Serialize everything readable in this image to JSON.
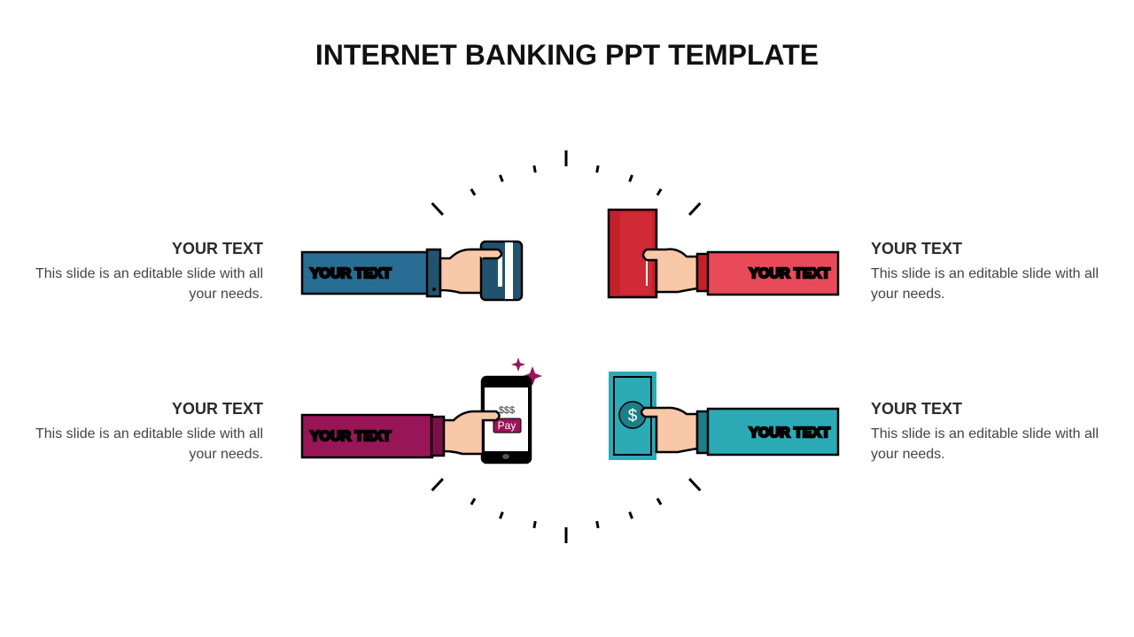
{
  "title": "INTERNET BANKING PPT TEMPLATE",
  "items": [
    {
      "heading": "YOUR TEXT",
      "body": "This slide is an editable slide with all your needs.",
      "arm_label": "YOUR TEXT",
      "color": "#286d94",
      "icon": "credit-card-icon"
    },
    {
      "heading": "YOUR TEXT",
      "body": "This slide is an editable slide with all your needs.",
      "arm_label": "YOUR TEXT",
      "color": "#e84a5a",
      "icon": "red-envelope-icon"
    },
    {
      "heading": "YOUR TEXT",
      "body": "This slide is an editable slide with all your needs.",
      "arm_label": "YOUR TEXT",
      "color": "#981558",
      "icon": "smartphone-pay-icon"
    },
    {
      "heading": "YOUR TEXT",
      "body": "This slide is an editable slide with all your needs.",
      "arm_label": "YOUR TEXT",
      "color": "#2caab6",
      "icon": "dollar-bill-icon"
    }
  ],
  "phone": {
    "amount": "$$$",
    "button": "Pay"
  },
  "bill": {
    "symbol": "$"
  }
}
